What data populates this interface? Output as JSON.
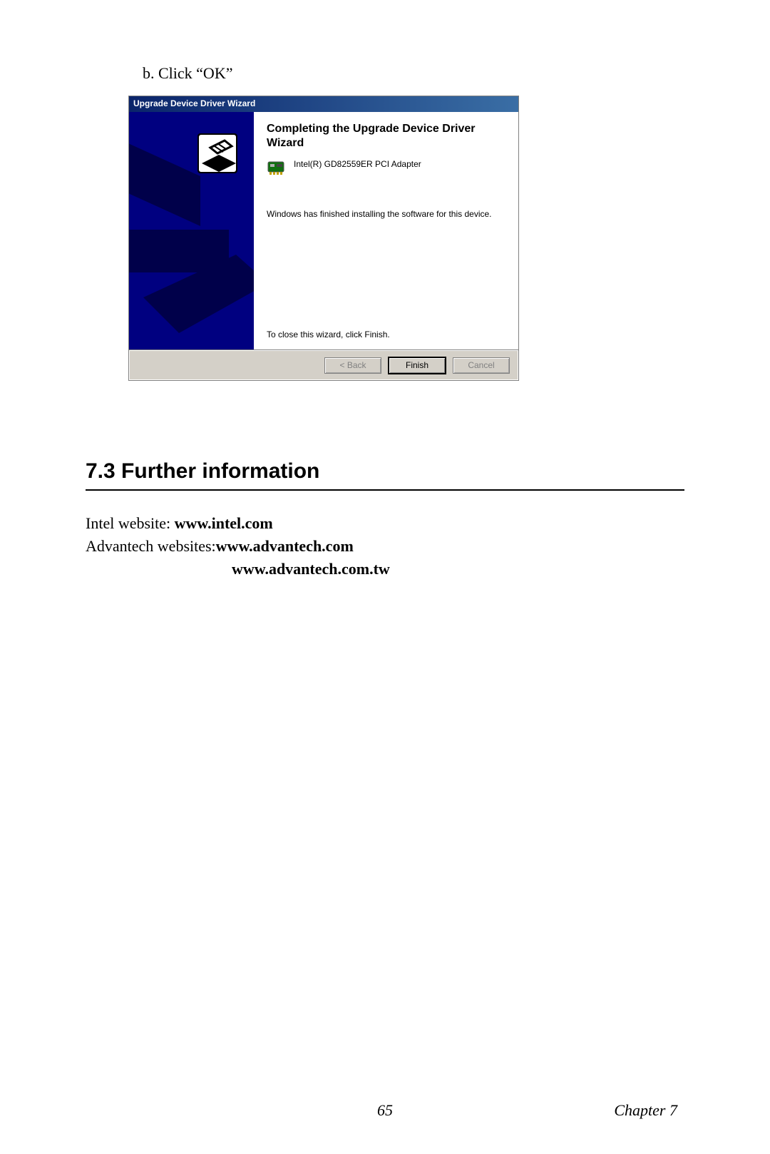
{
  "instruction": "b. Click “OK”",
  "dialog": {
    "title": "Upgrade Device Driver Wizard",
    "heading": "Completing the Upgrade Device Driver Wizard",
    "adapter_name": "Intel(R) GD82559ER PCI Adapter",
    "install_msg": "Windows has finished installing the software for this device.",
    "close_msg": "To close this wizard, click Finish.",
    "buttons": {
      "back": "< Back",
      "finish": "Finish",
      "cancel": "Cancel"
    }
  },
  "section_heading": "7.3  Further information",
  "links": {
    "intel_label": "Intel website: ",
    "intel_url": "www.intel.com",
    "adv_label": "Advantech websites:",
    "adv_url1": "www.advantech.com",
    "adv_url2": "www.advantech.com.tw"
  },
  "footer": {
    "page": "65",
    "chapter": "Chapter 7"
  }
}
